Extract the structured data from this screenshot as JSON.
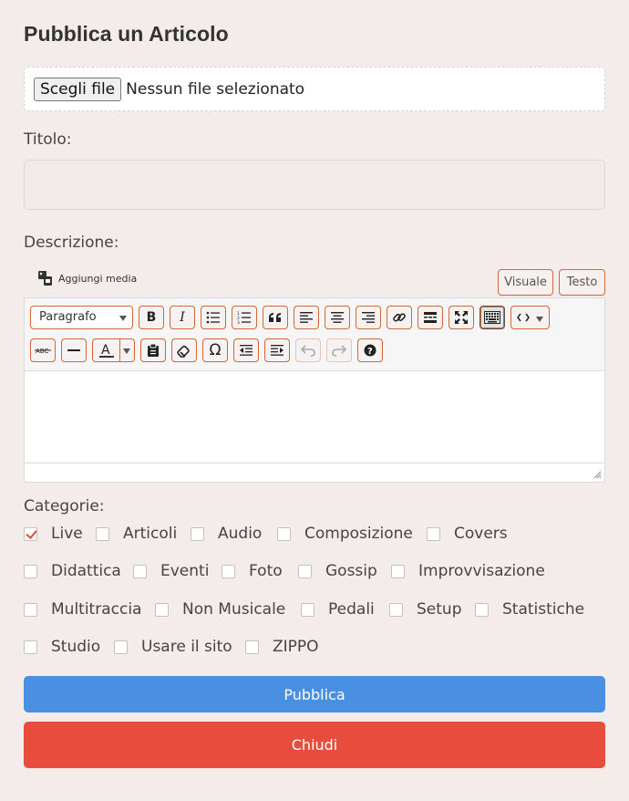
{
  "page": {
    "title": "Pubblica un Articolo"
  },
  "file": {
    "button_label": "Scegli file",
    "status": "Nessun file selezionato"
  },
  "fields": {
    "title_label": "Titolo:",
    "title_value": "",
    "description_label": "Descrizione:"
  },
  "editor": {
    "add_media_label": "Aggiungi media",
    "tab_visual": "Visuale",
    "tab_text": "Testo",
    "format_selected": "Paragrafo"
  },
  "categories": {
    "label": "Categorie:",
    "items": [
      {
        "label": "Live",
        "checked": true
      },
      {
        "label": "Articoli",
        "checked": false
      },
      {
        "label": "Audio",
        "checked": false
      },
      {
        "label": "Composizione",
        "checked": false
      },
      {
        "label": "Covers",
        "checked": false
      },
      {
        "label": "Didattica",
        "checked": false
      },
      {
        "label": "Eventi",
        "checked": false
      },
      {
        "label": "Foto",
        "checked": false
      },
      {
        "label": "Gossip",
        "checked": false
      },
      {
        "label": "Improvvisazione",
        "checked": false
      },
      {
        "label": "Multitraccia",
        "checked": false
      },
      {
        "label": "Non Musicale",
        "checked": false
      },
      {
        "label": "Pedali",
        "checked": false
      },
      {
        "label": "Setup",
        "checked": false
      },
      {
        "label": "Statistiche",
        "checked": false
      },
      {
        "label": "Studio",
        "checked": false
      },
      {
        "label": "Usare il sito",
        "checked": false
      },
      {
        "label": "ZIPPO",
        "checked": false
      }
    ]
  },
  "actions": {
    "publish_label": "Pubblica",
    "close_label": "Chiudi"
  },
  "colors": {
    "accent": "#d5662f",
    "publish": "#4a90e2",
    "close": "#e74c3c",
    "background": "#f4eceb"
  }
}
